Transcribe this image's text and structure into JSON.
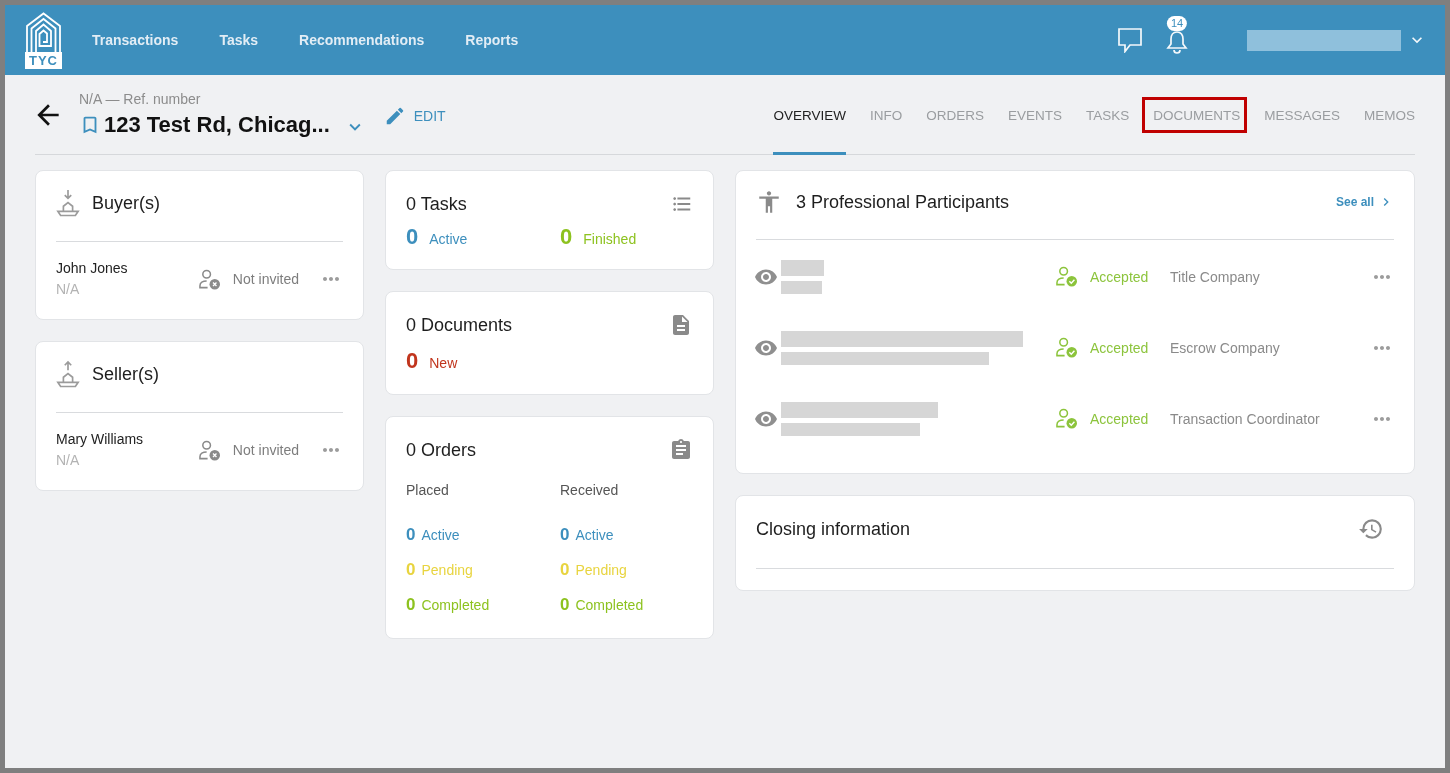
{
  "header": {
    "logo": "TYC",
    "nav": [
      {
        "label": "Transactions"
      },
      {
        "label": "Tasks"
      },
      {
        "label": "Recommendations"
      },
      {
        "label": "Reports"
      }
    ],
    "notifications": "14"
  },
  "transaction": {
    "ref": "N/A — Ref. number",
    "address": "123 Test Rd, Chicag...",
    "edit": "EDIT"
  },
  "tabs": [
    {
      "label": "OVERVIEW",
      "selected": true,
      "highlighted": false
    },
    {
      "label": "INFO",
      "selected": false,
      "highlighted": false
    },
    {
      "label": "ORDERS",
      "selected": false,
      "highlighted": false
    },
    {
      "label": "EVENTS",
      "selected": false,
      "highlighted": false
    },
    {
      "label": "TASKS",
      "selected": false,
      "highlighted": false
    },
    {
      "label": "DOCUMENTS",
      "selected": false,
      "highlighted": true
    },
    {
      "label": "MESSAGES",
      "selected": false,
      "highlighted": false
    },
    {
      "label": "MEMOS",
      "selected": false,
      "highlighted": false
    }
  ],
  "parties": [
    {
      "kind": "buyer",
      "title": "Buyer(s)",
      "people": [
        {
          "name": "John Jones",
          "detail": "N/A",
          "status": "Not invited",
          "accepted": false
        }
      ]
    },
    {
      "kind": "seller",
      "title": "Seller(s)",
      "people": [
        {
          "name": "Mary Williams",
          "detail": "N/A",
          "status": "Not invited",
          "accepted": false
        }
      ]
    }
  ],
  "tasks": {
    "title": "0 Tasks",
    "stats": [
      {
        "count": "0",
        "label": "Active",
        "color": "#3d8fbd"
      },
      {
        "count": "0",
        "label": "Finished",
        "color": "#8dc21f"
      }
    ]
  },
  "documents": {
    "title": "0 Documents",
    "stats": [
      {
        "count": "0",
        "label": "New",
        "color": "#c1351d"
      }
    ]
  },
  "orders": {
    "title": "0 Orders",
    "groups": [
      {
        "heading": "Placed",
        "stats": [
          {
            "count": "0",
            "label": "Active",
            "color": "#3d8fbd"
          },
          {
            "count": "0",
            "label": "Pending",
            "color": "#e8d43f"
          },
          {
            "count": "0",
            "label": "Completed",
            "color": "#8dc21f"
          }
        ]
      },
      {
        "heading": "Received",
        "stats": [
          {
            "count": "0",
            "label": "Active",
            "color": "#3d8fbd"
          },
          {
            "count": "0",
            "label": "Pending",
            "color": "#e8d43f"
          },
          {
            "count": "0",
            "label": "Completed",
            "color": "#8dc21f"
          }
        ]
      }
    ]
  },
  "participants": {
    "title": "3 Professional Participants",
    "see_all": "See all",
    "rows": [
      {
        "status": "Accepted",
        "accepted": true,
        "role": "Title Company"
      },
      {
        "status": "Accepted",
        "accepted": true,
        "role": "Escrow Company"
      },
      {
        "status": "Accepted",
        "accepted": true,
        "role": "Transaction Coordinator"
      }
    ]
  },
  "closing": {
    "title": "Closing information"
  }
}
